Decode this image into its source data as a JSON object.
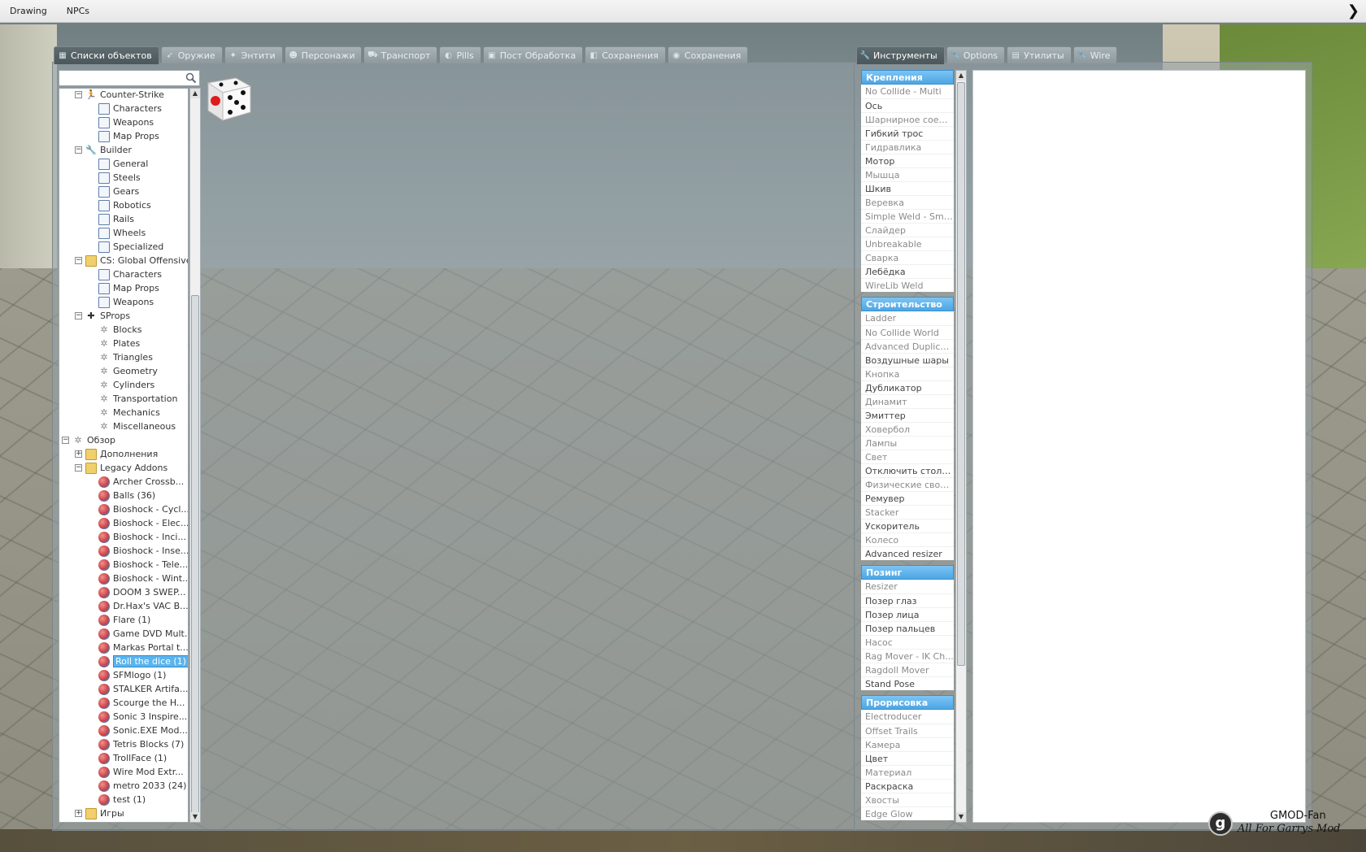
{
  "menubar": {
    "items": [
      "Drawing",
      "NPCs"
    ]
  },
  "left_tabs": [
    {
      "label": "Списки объектов",
      "icon": "grid-icon",
      "active": true
    },
    {
      "label": "Оружие",
      "icon": "gun-icon"
    },
    {
      "label": "Энтити",
      "icon": "entity-icon"
    },
    {
      "label": "Персонажи",
      "icon": "face-icon"
    },
    {
      "label": "Транспорт",
      "icon": "vehicle-icon"
    },
    {
      "label": "Pills",
      "icon": "pill-icon"
    },
    {
      "label": "Пост Обработка",
      "icon": "image-icon"
    },
    {
      "label": "Сохранения",
      "icon": "save-icon"
    },
    {
      "label": "Сохранения",
      "icon": "disk-icon"
    }
  ],
  "right_tabs": [
    {
      "label": "Инструменты",
      "icon": "wrench-icon",
      "active": true
    },
    {
      "label": "Options",
      "icon": "wrench-icon"
    },
    {
      "label": "Утилиты",
      "icon": "doc-icon"
    },
    {
      "label": "Wire",
      "icon": "wrench-icon"
    }
  ],
  "search": {
    "placeholder": "",
    "value": ""
  },
  "tree": [
    {
      "label": "Counter-Strike",
      "depth": 1,
      "icon": "cs-icon",
      "toggle": "−"
    },
    {
      "label": "Characters",
      "depth": 2,
      "icon": "page-icon"
    },
    {
      "label": "Weapons",
      "depth": 2,
      "icon": "page-icon"
    },
    {
      "label": "Map Props",
      "depth": 2,
      "icon": "page-icon"
    },
    {
      "label": "Builder",
      "depth": 1,
      "icon": "wrench-icon",
      "toggle": "−"
    },
    {
      "label": "General",
      "depth": 2,
      "icon": "page-icon"
    },
    {
      "label": "Steels",
      "depth": 2,
      "icon": "page-icon"
    },
    {
      "label": "Gears",
      "depth": 2,
      "icon": "page-icon"
    },
    {
      "label": "Robotics",
      "depth": 2,
      "icon": "page-icon"
    },
    {
      "label": "Rails",
      "depth": 2,
      "icon": "page-icon"
    },
    {
      "label": "Wheels",
      "depth": 2,
      "icon": "page-icon"
    },
    {
      "label": "Specialized",
      "depth": 2,
      "icon": "page-icon"
    },
    {
      "label": "CS: Global Offensive",
      "depth": 1,
      "icon": "folder-icon",
      "toggle": "−"
    },
    {
      "label": "Characters",
      "depth": 2,
      "icon": "page-icon"
    },
    {
      "label": "Map Props",
      "depth": 2,
      "icon": "page-icon"
    },
    {
      "label": "Weapons",
      "depth": 2,
      "icon": "page-icon"
    },
    {
      "label": "SProps",
      "depth": 1,
      "icon": "puzzle-icon",
      "toggle": "−"
    },
    {
      "label": "Blocks",
      "depth": 2,
      "icon": "gear-icon"
    },
    {
      "label": "Plates",
      "depth": 2,
      "icon": "gear-icon"
    },
    {
      "label": "Triangles",
      "depth": 2,
      "icon": "gear-icon"
    },
    {
      "label": "Geometry",
      "depth": 2,
      "icon": "gear-icon"
    },
    {
      "label": "Cylinders",
      "depth": 2,
      "icon": "gear-icon"
    },
    {
      "label": "Transportation",
      "depth": 2,
      "icon": "gear-icon"
    },
    {
      "label": "Mechanics",
      "depth": 2,
      "icon": "gear-icon"
    },
    {
      "label": "Miscellaneous",
      "depth": 2,
      "icon": "gear-icon"
    },
    {
      "label": "Обзор",
      "depth": 0,
      "icon": "gear-icon",
      "toggle": "−"
    },
    {
      "label": "Дополнения",
      "depth": 1,
      "icon": "folder-icon",
      "toggle": "+"
    },
    {
      "label": "Legacy Addons",
      "depth": 1,
      "icon": "folder-icon",
      "toggle": "−"
    },
    {
      "label": "Archer Crossb...",
      "depth": 2,
      "icon": "addon-icon"
    },
    {
      "label": "Balls (36)",
      "depth": 2,
      "icon": "addon-icon"
    },
    {
      "label": "Bioshock - Cycl...",
      "depth": 2,
      "icon": "addon-icon"
    },
    {
      "label": "Bioshock - Elec...",
      "depth": 2,
      "icon": "addon-icon"
    },
    {
      "label": "Bioshock - Inci...",
      "depth": 2,
      "icon": "addon-icon"
    },
    {
      "label": "Bioshock - Inse...",
      "depth": 2,
      "icon": "addon-icon"
    },
    {
      "label": "Bioshock - Tele...",
      "depth": 2,
      "icon": "addon-icon"
    },
    {
      "label": "Bioshock - Wint...",
      "depth": 2,
      "icon": "addon-icon"
    },
    {
      "label": "DOOM 3 SWEP...",
      "depth": 2,
      "icon": "addon-icon"
    },
    {
      "label": "Dr.Hax's VAC B...",
      "depth": 2,
      "icon": "addon-icon"
    },
    {
      "label": "Flare (1)",
      "depth": 2,
      "icon": "addon-icon"
    },
    {
      "label": "Game DVD Mult...",
      "depth": 2,
      "icon": "addon-icon"
    },
    {
      "label": "Markas Portal t...",
      "depth": 2,
      "icon": "addon-icon"
    },
    {
      "label": "Roll the dice (1)",
      "depth": 2,
      "icon": "addon-icon",
      "selected": true
    },
    {
      "label": "SFMlogo (1)",
      "depth": 2,
      "icon": "addon-icon"
    },
    {
      "label": "STALKER Artifa...",
      "depth": 2,
      "icon": "addon-icon"
    },
    {
      "label": "Scourge the H...",
      "depth": 2,
      "icon": "addon-icon"
    },
    {
      "label": "Sonic 3 Inspire...",
      "depth": 2,
      "icon": "addon-icon"
    },
    {
      "label": "Sonic.EXE Mod...",
      "depth": 2,
      "icon": "addon-icon"
    },
    {
      "label": "Tetris Blocks (7)",
      "depth": 2,
      "icon": "addon-icon"
    },
    {
      "label": "TrollFace (1)",
      "depth": 2,
      "icon": "addon-icon"
    },
    {
      "label": "Wire Mod Extr...",
      "depth": 2,
      "icon": "addon-icon"
    },
    {
      "label": "metro 2033 (24)",
      "depth": 2,
      "icon": "addon-icon"
    },
    {
      "label": "test (1)",
      "depth": 2,
      "icon": "addon-icon"
    },
    {
      "label": "Игры",
      "depth": 1,
      "icon": "folder-icon",
      "toggle": "+"
    }
  ],
  "tools": [
    {
      "category": "Крепления",
      "items": [
        {
          "label": "No Collide - Multi",
          "dim": true
        },
        {
          "label": "Ось"
        },
        {
          "label": "Шарнирное соеди...",
          "dim": true
        },
        {
          "label": "Гибкий трос"
        },
        {
          "label": "Гидравлика",
          "dim": true
        },
        {
          "label": "Мотор"
        },
        {
          "label": "Мышца",
          "dim": true
        },
        {
          "label": "Шкив"
        },
        {
          "label": "Веревка",
          "dim": true
        },
        {
          "label": "Simple Weld - Smart",
          "dim": true
        },
        {
          "label": "Слайдер",
          "dim": true
        },
        {
          "label": "Unbreakable",
          "dim": true
        },
        {
          "label": "Сварка",
          "dim": true
        },
        {
          "label": "Лебёдка"
        },
        {
          "label": "WireLib Weld",
          "dim": true
        }
      ]
    },
    {
      "category": "Строительство",
      "items": [
        {
          "label": "Ladder",
          "dim": true
        },
        {
          "label": "No Collide World",
          "dim": true
        },
        {
          "label": "Advanced Duplicator",
          "dim": true
        },
        {
          "label": "Воздушные шары"
        },
        {
          "label": "Кнопка",
          "dim": true
        },
        {
          "label": "Дубликатор"
        },
        {
          "label": "Динамит",
          "dim": true
        },
        {
          "label": "Эмиттер"
        },
        {
          "label": "Ховербол",
          "dim": true
        },
        {
          "label": "Лампы",
          "dim": true
        },
        {
          "label": "Свет",
          "dim": true
        },
        {
          "label": "Отключить столк..."
        },
        {
          "label": "Физические свойс...",
          "dim": true
        },
        {
          "label": "Ремувер"
        },
        {
          "label": "Stacker",
          "dim": true
        },
        {
          "label": "Ускоритель"
        },
        {
          "label": "Колесо",
          "dim": true
        },
        {
          "label": "Advanced resizer"
        }
      ]
    },
    {
      "category": "Позинг",
      "items": [
        {
          "label": "Resizer",
          "dim": true
        },
        {
          "label": "Позер глаз"
        },
        {
          "label": "Позер лица"
        },
        {
          "label": "Позер пальцев"
        },
        {
          "label": "Насос",
          "dim": true
        },
        {
          "label": "Rag Mover - IK Ch...",
          "dim": true
        },
        {
          "label": "Ragdoll Mover",
          "dim": true
        },
        {
          "label": "Stand Pose"
        }
      ]
    },
    {
      "category": "Прорисовка",
      "items": [
        {
          "label": "Electroducer",
          "dim": true
        },
        {
          "label": "Offset Trails",
          "dim": true
        },
        {
          "label": "Камера",
          "dim": true
        },
        {
          "label": "Цвет"
        },
        {
          "label": "Материал",
          "dim": true
        },
        {
          "label": "Раскраска"
        },
        {
          "label": "Хвосты",
          "dim": true
        },
        {
          "label": "Edge Glow",
          "dim": true
        }
      ]
    }
  ],
  "watermark": {
    "logo": "g",
    "line1": "GMOD-Fan",
    "line2": "All For Garrys Mod"
  },
  "colors": {
    "accent": "#4da6e3",
    "selection": "#5ab4ee"
  }
}
